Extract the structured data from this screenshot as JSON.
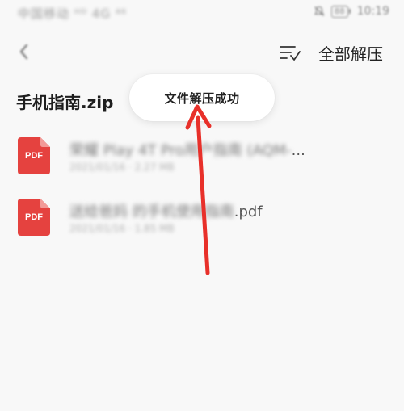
{
  "status_bar": {
    "carrier": "中国移动 ᴴᴰ 4G ⁴⁶",
    "battery": "88",
    "time": "10:19"
  },
  "top_bar": {
    "back_icon": "back-arrow-icon",
    "sort_icon": "sort-icon",
    "extract_all_label": "全部解压"
  },
  "archive": {
    "title": "手机指南.zip"
  },
  "toast": {
    "message": "文件解压成功"
  },
  "files": [
    {
      "icon": "pdf-file-icon",
      "icon_label": "PDF",
      "name_blurred": "荣耀 Play 4T Pro用户指南 (AQM-",
      "name_suffix": "...",
      "meta": "2021/01/16 · 2.27 MB"
    },
    {
      "icon": "pdf-file-icon",
      "icon_label": "PDF",
      "name_blurred": "送给爸妈 的手机使用指南",
      "name_suffix": ".pdf",
      "meta": "2021/01/16 · 1.85 MB"
    }
  ],
  "colors": {
    "background": "#f8f8f8",
    "pdf_red": "#e5423f",
    "annotation_arrow": "#e8302a"
  }
}
